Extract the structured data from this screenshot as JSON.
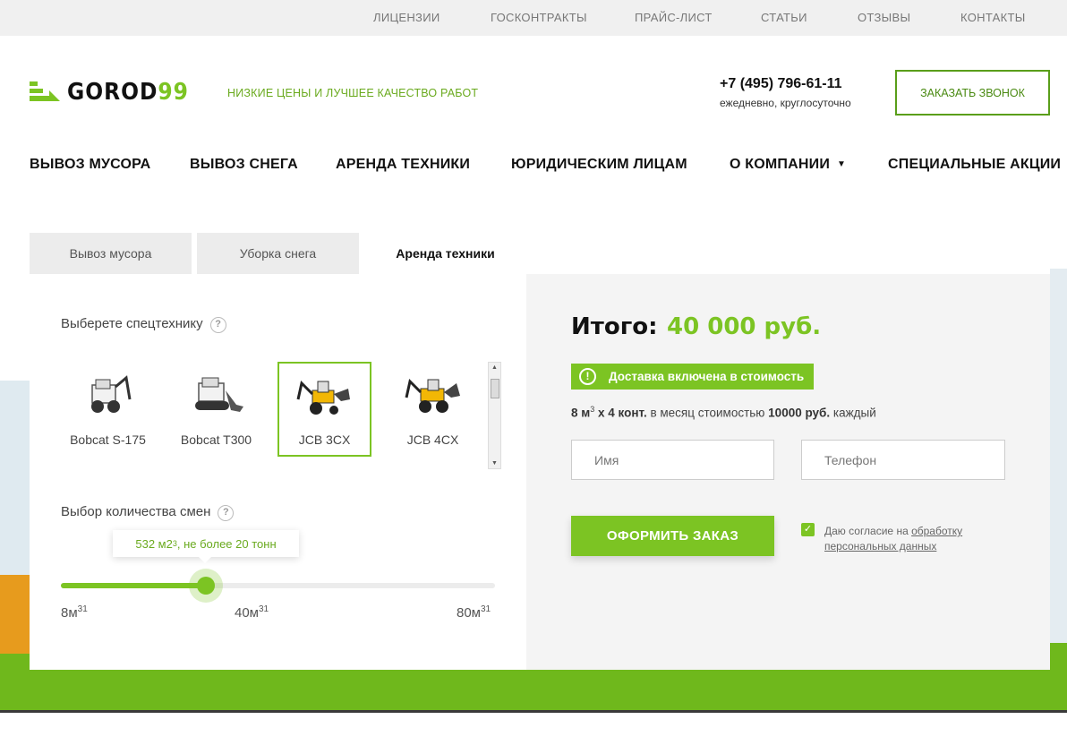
{
  "topnav": [
    "ЛИЦЕНЗИИ",
    "ГОСКОНТРАКТЫ",
    "ПРАЙС-ЛИСТ",
    "СТАТЬИ",
    "ОТЗЫВЫ",
    "КОНТАКТЫ"
  ],
  "logo": {
    "text": "GOROD",
    "num": "99"
  },
  "slogan": "НИЗКИЕ ЦЕНЫ И ЛУЧШЕЕ КАЧЕСТВО РАБОТ",
  "phone": "+7 (495) 796-61-11",
  "phone_sub": "ежедневно, круглосуточно",
  "callback": "ЗАКАЗАТЬ ЗВОНОК",
  "mainnav": [
    "ВЫВОЗ МУСОРА",
    "ВЫВОЗ СНЕГА",
    "АРЕНДА ТЕХНИКИ",
    "ЮРИДИЧЕСКИМ ЛИЦАМ",
    "О КОМПАНИИ",
    "СПЕЦИАЛЬНЫЕ АКЦИИ"
  ],
  "tabs": [
    "Вывоз мусора",
    "Уборка снега",
    "Аренда техники"
  ],
  "machine_label": "Выберете спецтехнику",
  "machines": [
    "Bobcat S-175",
    "Bobcat T300",
    "JCB 3CX",
    "JCB 4CX"
  ],
  "selected_machine": "JCB 3CX",
  "shifts_label": "Выбор количества смен",
  "tooltip": {
    "value": "532 м2",
    "sup": "3",
    "rest": ", не более 20 тонн"
  },
  "slider": {
    "min_label": "8м",
    "mid_label": "40м",
    "max_label": "80м",
    "sup": "31",
    "level": 0.335
  },
  "total_label": "Итого:",
  "total_value": "40 000 руб.",
  "delivery": "Доставка включена в стоимость",
  "info": {
    "vol": "8 м",
    "sup": "3",
    "cont": " x 4 конт.",
    "mid": " в месяц стоимостью ",
    "price": "10000 руб.",
    "end": " каждый"
  },
  "name_placeholder": "Имя",
  "phone_placeholder": "Телефон",
  "order_button": "ОФОРМИТЬ ЗАКАЗ",
  "consent_text": "Даю согласие на ",
  "consent_link1": "обработку",
  "consent_link2": "персональных данных",
  "colors": {
    "accent": "#7cc423",
    "dark_accent": "#5a9e1a"
  }
}
